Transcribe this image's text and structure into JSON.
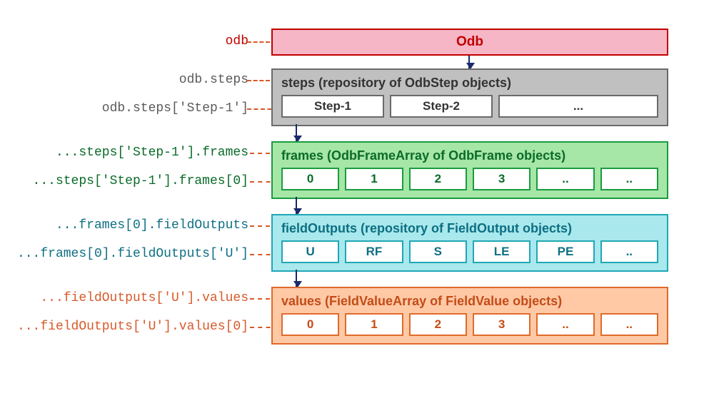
{
  "odb": {
    "label": "odb",
    "title": "Odb"
  },
  "steps": {
    "label1": "odb.steps",
    "label2": "odb.steps['Step-1']",
    "title": "steps (repository of OdbStep objects)",
    "cells": [
      "Step-1",
      "Step-2",
      "..."
    ]
  },
  "frames": {
    "label1": "...steps['Step-1'].frames",
    "label2": "...steps['Step-1'].frames[0]",
    "title": "frames (OdbFrameArray of OdbFrame objects)",
    "cells": [
      "0",
      "1",
      "2",
      "3",
      "..",
      ".."
    ]
  },
  "fieldOutputs": {
    "label1": "...frames[0].fieldOutputs",
    "label2": "...frames[0].fieldOutputs['U']",
    "title": "fieldOutputs (repository of FieldOutput objects)",
    "cells": [
      "U",
      "RF",
      "S",
      "LE",
      "PE",
      ".."
    ]
  },
  "values": {
    "label1": "...fieldOutputs['U'].values",
    "label2": "...fieldOutputs['U'].values[0]",
    "title": "values (FieldValueArray of FieldValue objects)",
    "cells": [
      "0",
      "1",
      "2",
      "3",
      "..",
      ".."
    ]
  }
}
